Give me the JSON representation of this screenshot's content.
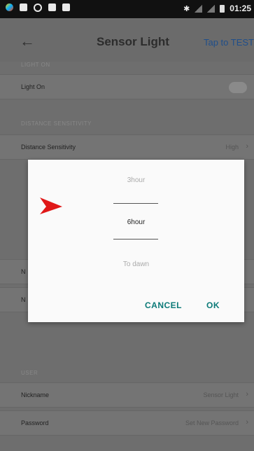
{
  "status_bar": {
    "time": "01:25"
  },
  "app_bar": {
    "title": "Sensor Light",
    "action": "Tap to TEST"
  },
  "sections": {
    "light_on_header": "LIGHT ON",
    "distance_header": "DISTANCE SENSITIVITY",
    "user_header": "USER"
  },
  "rows": {
    "light_on": {
      "label": "Light On"
    },
    "distance": {
      "label": "Distance Sensitivity",
      "value": "High"
    },
    "partial_1": {
      "label": "N"
    },
    "partial_2": {
      "label": "N"
    },
    "nickname": {
      "label": "Nickname",
      "value": "Sensor Light"
    },
    "password": {
      "label": "Password",
      "value": "Set New Password"
    }
  },
  "dialog": {
    "options": [
      "3hour",
      "6hour",
      "To dawn"
    ],
    "selected_index": 1,
    "cancel_label": "CANCEL",
    "ok_label": "OK"
  },
  "colors": {
    "accent": "#0c7a78",
    "arrow": "#e01818",
    "link": "#1f4e8a"
  }
}
